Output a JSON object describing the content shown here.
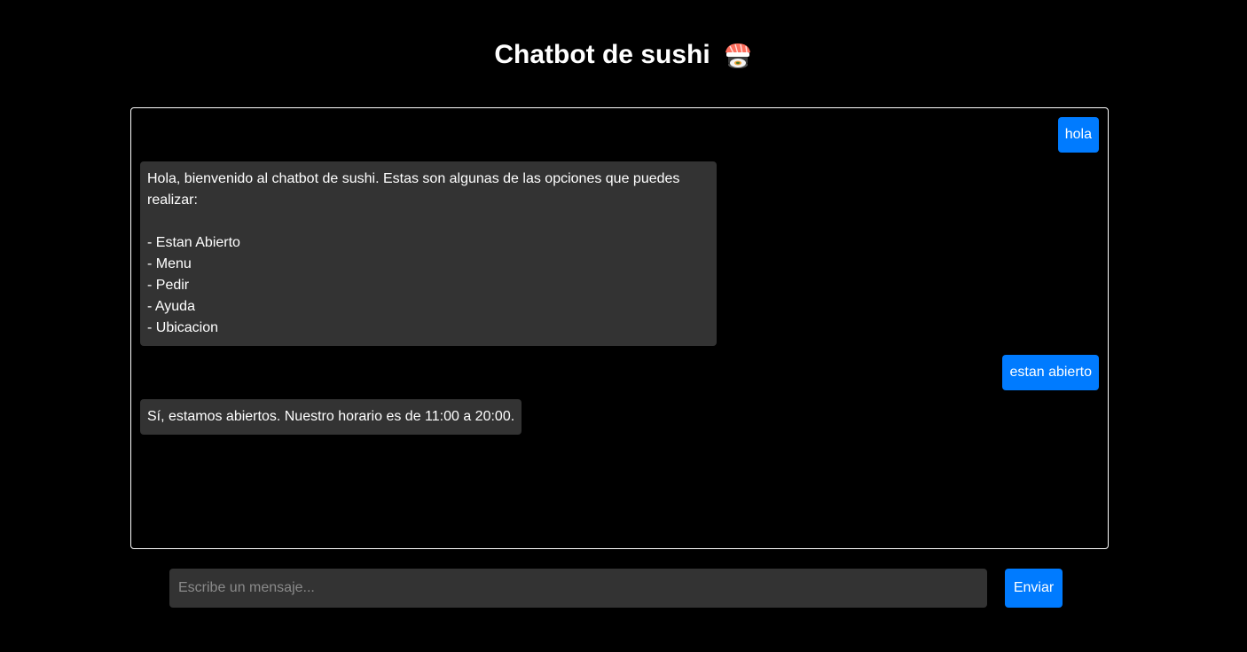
{
  "header": {
    "title": "Chatbot de sushi",
    "icon": "sushi-icon"
  },
  "chat": {
    "messages": [
      {
        "sender": "user",
        "text": "hola"
      },
      {
        "sender": "bot",
        "text": "Hola, bienvenido al chatbot de sushi. Estas son algunas de las opciones que puedes realizar:\n\n- Estan Abierto\n- Menu\n- Pedir\n- Ayuda\n- Ubicacion"
      },
      {
        "sender": "user",
        "text": "estan abierto"
      },
      {
        "sender": "bot",
        "text": "Sí, estamos abiertos. Nuestro horario es de 11:00 a 20:00."
      }
    ]
  },
  "composer": {
    "placeholder": "Escribe un mensaje...",
    "value": "",
    "send_label": "Enviar"
  },
  "colors": {
    "background": "#000000",
    "user_bubble": "#007bff",
    "bot_bubble": "#333333",
    "accent": "#007bff"
  }
}
